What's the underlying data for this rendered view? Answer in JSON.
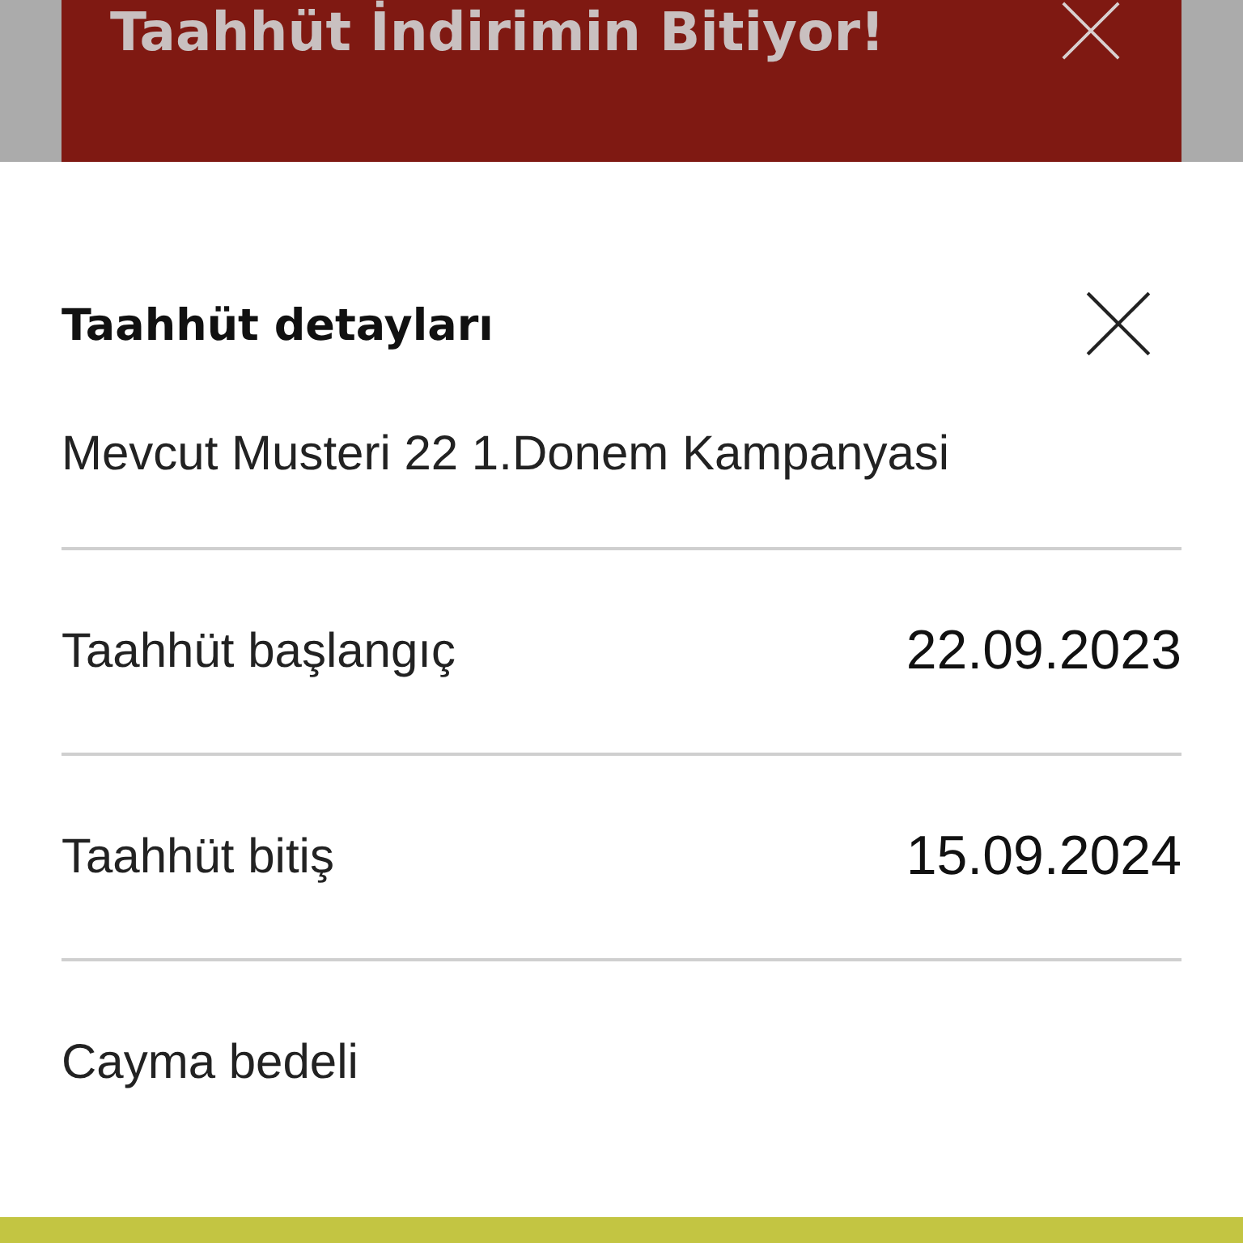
{
  "banner": {
    "title": "Taahhüt İndirimin Bitiyor!"
  },
  "sheet": {
    "title": "Taahhüt detayları",
    "campaign": "Mevcut Musteri 22 1.Donem Kampanyasi",
    "rows": [
      {
        "label": "Taahhüt başlangıç",
        "value": "22.09.2023"
      },
      {
        "label": "Taahhüt bitiş",
        "value": "15.09.2024"
      },
      {
        "label": "Cayma bedeli"
      }
    ]
  }
}
